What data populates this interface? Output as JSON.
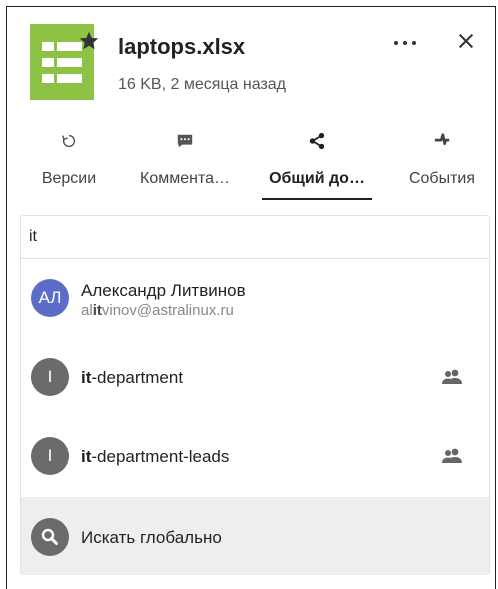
{
  "file": {
    "name": "laptops.xlsx",
    "meta": "16 KB, 2 месяца назад",
    "icon": "spreadsheet-icon",
    "icon_color": "#8ec244",
    "favorite_icon": "star-icon"
  },
  "header_actions": {
    "more": "more-horizontal-icon",
    "close": "close-icon"
  },
  "tabs": [
    {
      "label": "Версии",
      "icon": "history-icon",
      "active": false
    },
    {
      "label": "Коммента…",
      "icon": "comment-icon",
      "active": false
    },
    {
      "label": "Общий до…",
      "icon": "share-icon",
      "active": true
    },
    {
      "label": "События",
      "icon": "activity-icon",
      "active": false
    }
  ],
  "search": {
    "value": "it"
  },
  "results": [
    {
      "type": "user",
      "initials": "АЛ",
      "name": "Александр Литвинов",
      "email_before": "al",
      "email_match": "it",
      "email_after": "vinov@astralinux.ru",
      "avatar_color": "#5b6ec7"
    },
    {
      "type": "group",
      "initials": "I",
      "name_match": "it",
      "name_rest": "-department",
      "avatar_color": "#6b6b6b",
      "icon": "group-icon"
    },
    {
      "type": "group",
      "initials": "I",
      "name_match": "it",
      "name_rest": "-department-leads",
      "avatar_color": "#6b6b6b",
      "icon": "group-icon"
    }
  ],
  "global_search": {
    "label": "Искать глобально",
    "icon": "search-icon"
  }
}
